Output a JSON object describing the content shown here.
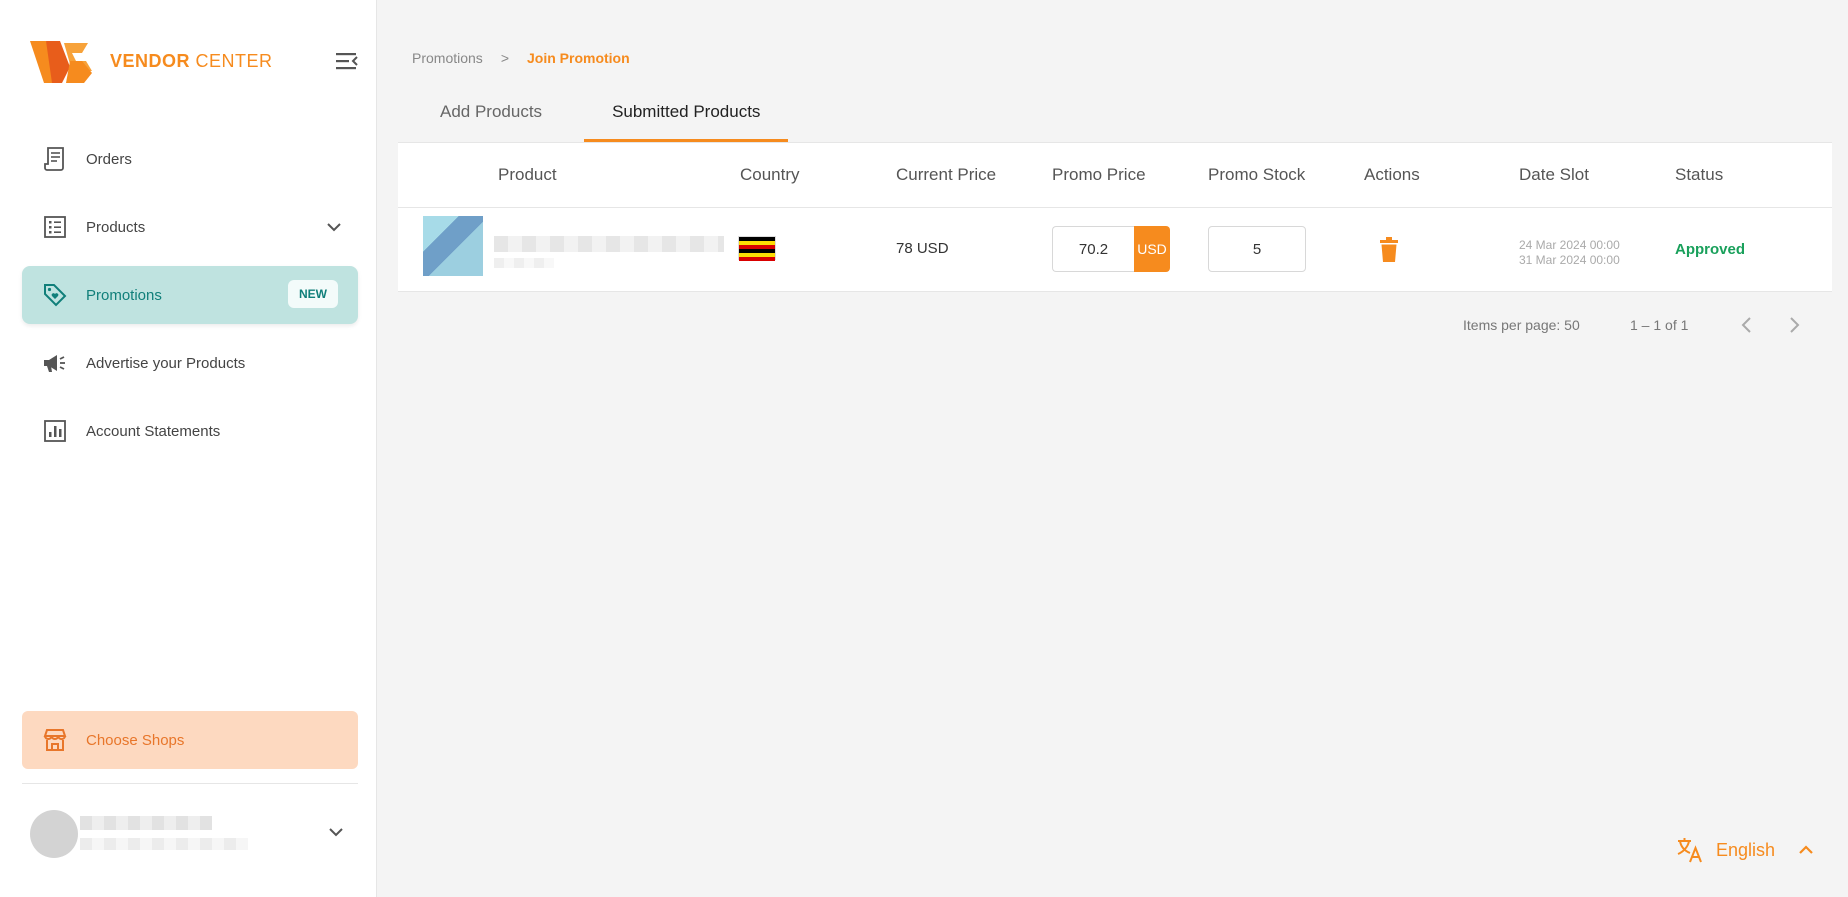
{
  "brand": {
    "name_bold": "VENDOR",
    "name_light": "CENTER"
  },
  "sidebar": {
    "items": [
      {
        "label": "Orders",
        "icon": "receipt-icon"
      },
      {
        "label": "Products",
        "icon": "list-icon",
        "has_submenu": true
      },
      {
        "label": "Promotions",
        "icon": "tag-heart-icon",
        "badge": "NEW",
        "active": true
      },
      {
        "label": "Advertise your Products",
        "icon": "megaphone-icon"
      },
      {
        "label": "Account Statements",
        "icon": "bar-chart-icon"
      }
    ],
    "choose_shops": "Choose Shops"
  },
  "breadcrumb": {
    "parent": "Promotions",
    "separator": ">",
    "current": "Join Promotion"
  },
  "tabs": [
    {
      "label": "Add Products",
      "active": false
    },
    {
      "label": "Submitted Products",
      "active": true
    }
  ],
  "table": {
    "columns": [
      "Product",
      "Country",
      "Current Price",
      "Promo Price",
      "Promo Stock",
      "Actions",
      "Date Slot",
      "Status"
    ],
    "rows": [
      {
        "current_price": "78 USD",
        "promo_price": "70.2",
        "promo_currency": "USD",
        "promo_stock": "5",
        "date_start": "24 Mar 2024 00:00",
        "date_end": "31 Mar 2024 00:00",
        "status": "Approved"
      }
    ]
  },
  "pagination": {
    "items_per_page": "Items per page: 50",
    "range": "1 – 1 of 1"
  },
  "language": {
    "label": "English"
  },
  "colors": {
    "accent": "#f68b1e",
    "teal": "#107f7a",
    "active_bg": "#bfe3e0",
    "approved": "#19a05b"
  }
}
